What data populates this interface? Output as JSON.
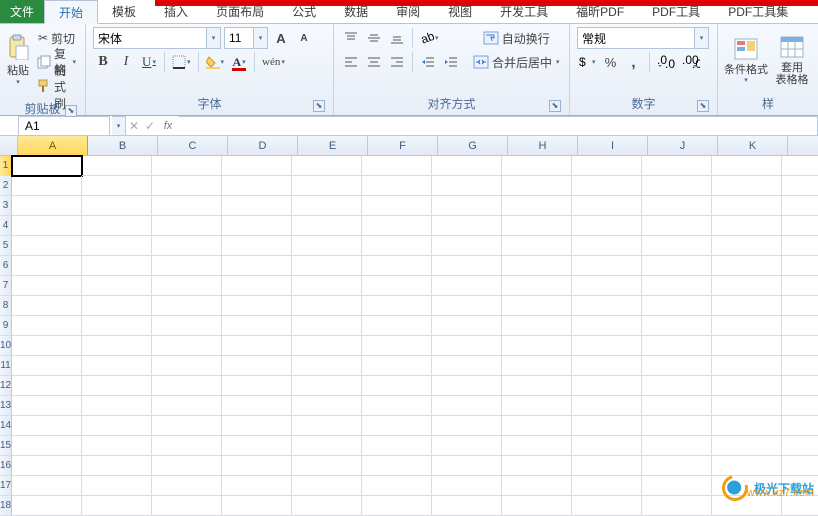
{
  "menu": {
    "file": "文件",
    "tabs": [
      "开始",
      "模板",
      "插入",
      "页面布局",
      "公式",
      "数据",
      "审阅",
      "视图",
      "开发工具",
      "福昕PDF",
      "PDF工具",
      "PDF工具集"
    ],
    "active": 0
  },
  "clipboard": {
    "title": "剪贴板",
    "paste": "粘贴",
    "cut": "剪切",
    "copy": "复制",
    "painter": "格式刷"
  },
  "font": {
    "title": "字体",
    "name": "宋体",
    "size": "11",
    "increase": "A",
    "decrease": "A",
    "bold": "B",
    "italic": "I",
    "underline": "U"
  },
  "align": {
    "title": "对齐方式",
    "wrap": "自动换行",
    "merge": "合并后居中"
  },
  "number": {
    "title": "数字",
    "format": "常规",
    "percent": "%",
    "comma": ","
  },
  "styles": {
    "title": "样",
    "cond": "条件格式",
    "tbl": "套用\n表格格"
  },
  "namebox": {
    "cell": "A1",
    "fx": "fx"
  },
  "cols": [
    "A",
    "B",
    "C",
    "D",
    "E",
    "F",
    "G",
    "H",
    "I",
    "J",
    "K"
  ],
  "rowcount": 18,
  "active_cell": {
    "r": 0,
    "c": 0
  },
  "watermark": {
    "t1": "极光下载站",
    "t2": "www.xz7.com"
  }
}
